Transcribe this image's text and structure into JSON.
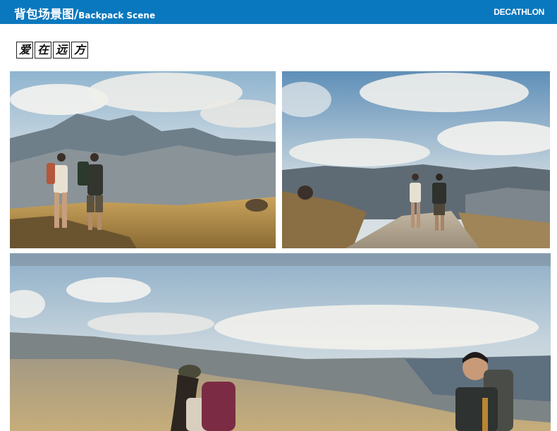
{
  "header": {
    "title_cn": "背包场景图/",
    "title_en": "Backpack Scene",
    "brand": "DECATHLON",
    "bar_color": "#0a78be"
  },
  "stamp": {
    "chars": [
      "爱",
      "在",
      "远",
      "方"
    ]
  },
  "photos": [
    {
      "name": "hikers-mountain-left",
      "scene": "two hikers on ridge with mountains"
    },
    {
      "name": "hikers-trail-right",
      "scene": "two hikers walking on gravel road"
    },
    {
      "name": "hikers-closeup-bottom",
      "scene": "close-up of two hikers with backpacks"
    }
  ]
}
